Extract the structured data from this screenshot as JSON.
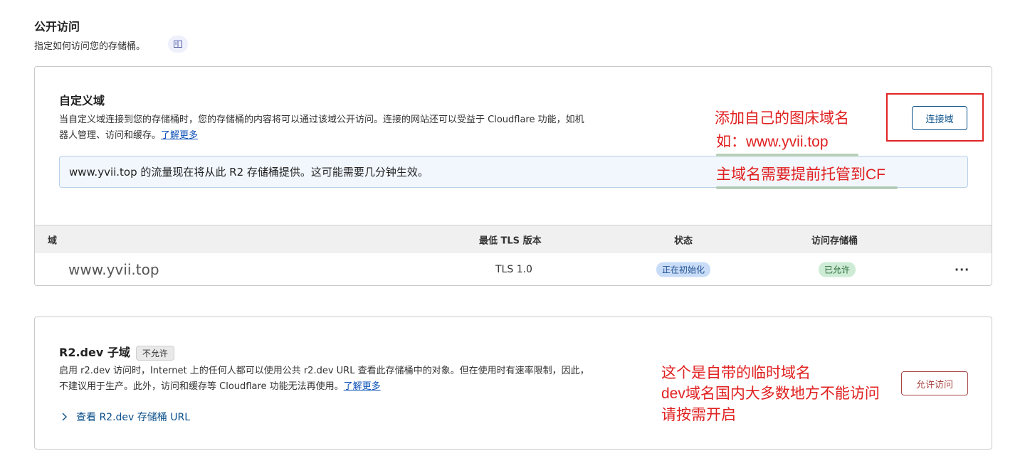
{
  "header": {
    "title": "公开访问",
    "description": "指定如何访问您的存储桶。",
    "doc_icon": "document-icon"
  },
  "custom_domain": {
    "title": "自定义域",
    "desc_line1": "当自定义域连接到您的存储桶时，您的存储桶的内容将可以通过该域公开访问。连接的网站还可以受益于 Cloudflare 功能，如机",
    "desc_line2": "器人管理、访问和缓存。",
    "learn_more": "了解更多",
    "connect_button": "连接域",
    "banner": "www.yvii.top 的流量现在将从此 R2 存储桶提供。这可能需要几分钟生效。",
    "table": {
      "columns": [
        "域",
        "最低 TLS 版本",
        "状态",
        "访问存储桶"
      ],
      "rows": [
        {
          "domain": "www.yvii.top",
          "tls": "TLS 1.0",
          "status": "正在初始化",
          "access": "已允许",
          "more": "···"
        }
      ]
    }
  },
  "r2dev": {
    "title": "R2.dev 子域",
    "tag": "不允许",
    "desc_line1": "启用 r2.dev 访问时，Internet 上的任何人都可以使用公共 r2.dev URL 查看此存储桶中的对象。但在使用时有速率限制，因此，",
    "desc_line2": "不建议用于生产。此外，访问和缓存等 Cloudflare 功能无法再使用。",
    "learn_more": "了解更多",
    "expand_label": "查看 R2.dev 存储桶 URL",
    "allow_button": "允许访问"
  },
  "annotations": {
    "a1": "添加自己的图床域名",
    "a2": "如：www.yvii.top",
    "a3": "主域名需要提前托管到CF",
    "b1": "这个是自带的临时域名",
    "b2": "dev域名国内大多数地方不能访问",
    "b3": "请按需开启"
  },
  "colors": {
    "annotation_red": "#e02020",
    "link_blue": "#0a4fb6",
    "status_blue_bg": "#c9dcf7",
    "status_green_bg": "#cdebd5"
  }
}
